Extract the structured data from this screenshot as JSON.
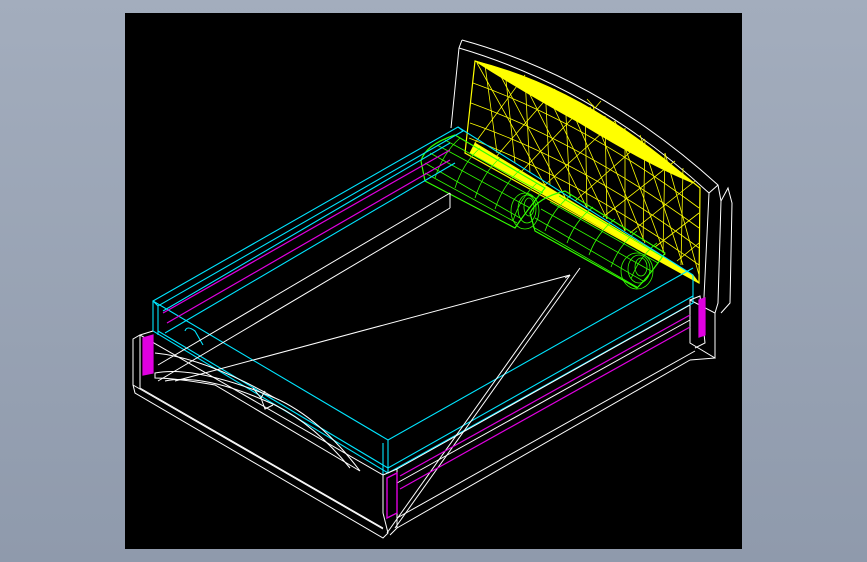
{
  "background": {
    "app": "#9aa4b5",
    "viewport": "#000000"
  },
  "colors": {
    "outline": "#ffffff",
    "mattress": "#00e5ff",
    "rail_trim": "#e000e0",
    "pillow": "#33ff00",
    "headboard_pad": "#ffff00"
  },
  "model": {
    "type": "3d-wireframe",
    "subject": "bed",
    "render_style": "wireframe"
  }
}
